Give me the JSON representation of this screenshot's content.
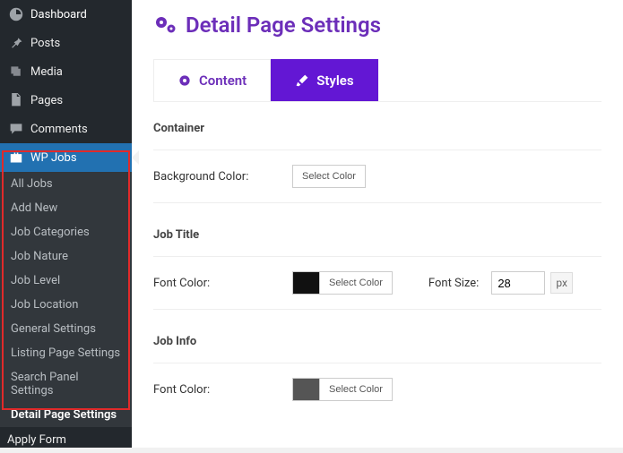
{
  "sidebar": {
    "top": [
      {
        "label": "Dashboard",
        "name": "menu-dashboard"
      },
      {
        "label": "Posts",
        "name": "menu-posts"
      },
      {
        "label": "Media",
        "name": "menu-media"
      },
      {
        "label": "Pages",
        "name": "menu-pages"
      },
      {
        "label": "Comments",
        "name": "menu-comments"
      }
    ],
    "active": {
      "label": "WP Jobs",
      "name": "menu-wp-jobs"
    },
    "sub": [
      {
        "label": "All Jobs",
        "name": "sub-all-jobs"
      },
      {
        "label": "Add New",
        "name": "sub-add-new"
      },
      {
        "label": "Job Categories",
        "name": "sub-job-categories"
      },
      {
        "label": "Job Nature",
        "name": "sub-job-nature"
      },
      {
        "label": "Job Level",
        "name": "sub-job-level"
      },
      {
        "label": "Job Location",
        "name": "sub-job-location"
      },
      {
        "label": "General Settings",
        "name": "sub-general-settings"
      },
      {
        "label": "Listing Page Settings",
        "name": "sub-listing-page-settings"
      },
      {
        "label": "Search Panel Settings",
        "name": "sub-search-panel-settings"
      },
      {
        "label": "Detail Page Settings",
        "name": "sub-detail-page-settings",
        "current": true
      }
    ],
    "after": [
      {
        "label": "Apply Form",
        "name": "menu-apply-form"
      }
    ]
  },
  "page": {
    "title": "Detail Page Settings",
    "tabs": {
      "content": "Content",
      "styles": "Styles"
    },
    "sections": {
      "container": {
        "title": "Container",
        "bg_label": "Background Color:",
        "select": "Select Color"
      },
      "job_title": {
        "title": "Job Title",
        "font_color_label": "Font Color:",
        "select": "Select Color",
        "font_size_label": "Font Size:",
        "font_size_value": "28",
        "unit": "px"
      },
      "job_info": {
        "title": "Job Info",
        "font_color_label": "Font Color:",
        "select": "Select Color"
      }
    }
  },
  "colors": {
    "accent_purple": "#6c2eb9",
    "tab_purple": "#6317d4",
    "sidebar_active": "#2271b1"
  }
}
